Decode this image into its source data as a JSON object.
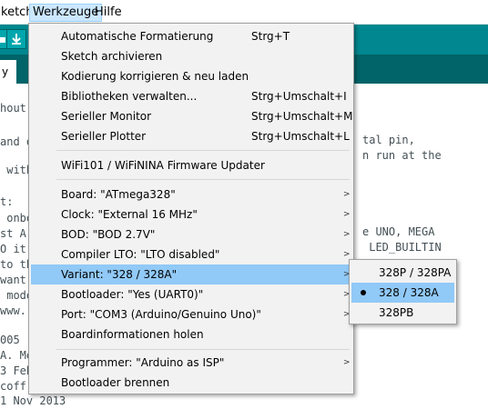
{
  "menubar": {
    "sketch": "ketch",
    "tools": "Werkzeuge",
    "help": "Hilfe"
  },
  "toolbar": {
    "new_icon": "new-sketch-icon",
    "save_icon": "save-icon",
    "accent": "#00878f"
  },
  "tab": {
    "label": "y"
  },
  "editor_lines": [
    "hout",
    "and o",
    " with",
    "t:",
    " onbo",
    "st A",
    "O it",
    "to th",
    "want",
    " mode",
    "www.",
    "005",
    "A. Me",
    "3 Feb",
    "coffr",
    "1 Nov 2013"
  ],
  "editor_right_lines": [
    "tal pin,",
    "n run at the",
    "e UNO, MEGA",
    " LED_BUILTIN"
  ],
  "tools_menu": {
    "items": [
      {
        "label": "Automatische Formatierung",
        "shortcut": "Strg+T"
      },
      {
        "label": "Sketch archivieren",
        "shortcut": ""
      },
      {
        "label": "Kodierung korrigieren & neu laden",
        "shortcut": ""
      },
      {
        "label": "Bibliotheken verwalten...",
        "shortcut": "Strg+Umschalt+I"
      },
      {
        "label": "Serieller Monitor",
        "shortcut": "Strg+Umschalt+M"
      },
      {
        "label": "Serieller Plotter",
        "shortcut": "Strg+Umschalt+L"
      },
      {
        "label": "WiFi101 / WiFiNINA Firmware Updater",
        "shortcut": ""
      },
      {
        "label": "Board: \"ATmega328\"",
        "shortcut": ""
      },
      {
        "label": "Clock: \"External 16 MHz\"",
        "shortcut": ""
      },
      {
        "label": "BOD: \"BOD 2.7V\"",
        "shortcut": ""
      },
      {
        "label": "Compiler LTO: \"LTO disabled\"",
        "shortcut": ""
      },
      {
        "label": "Variant: \"328 / 328A\"",
        "shortcut": ""
      },
      {
        "label": "Bootloader: \"Yes (UART0)\"",
        "shortcut": ""
      },
      {
        "label": "Port: \"COM3 (Arduino/Genuino Uno)\"",
        "shortcut": ""
      },
      {
        "label": "Boardinformationen holen",
        "shortcut": ""
      },
      {
        "label": "Programmer: \"Arduino as ISP\"",
        "shortcut": ""
      },
      {
        "label": "Bootloader brennen",
        "shortcut": ""
      }
    ],
    "highlight_color": "#91c9f7"
  },
  "variant_submenu": {
    "options": [
      "328P / 328PA",
      "328 / 328A",
      "328PB"
    ],
    "selected": "328 / 328A"
  }
}
